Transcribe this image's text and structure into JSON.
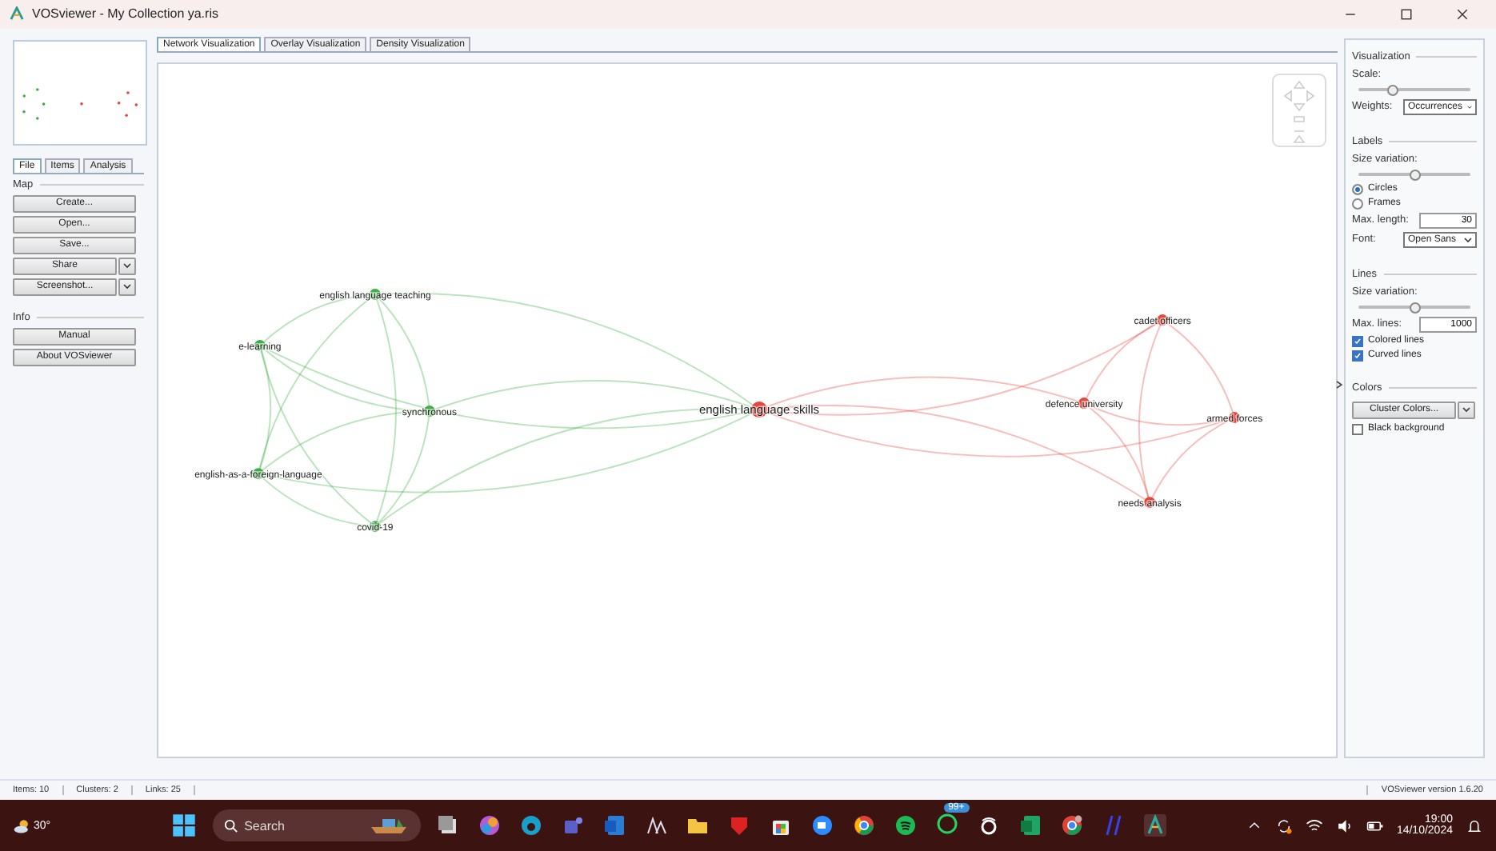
{
  "window": {
    "title": "VOSviewer - My Collection ya.ris"
  },
  "left_panel": {
    "tabs": [
      {
        "label": "File",
        "selected": true
      },
      {
        "label": "Items",
        "selected": false
      },
      {
        "label": "Analysis",
        "selected": false
      }
    ],
    "sections": [
      {
        "heading": "Map",
        "buttons": [
          {
            "label": "Create...",
            "kind": "plain"
          },
          {
            "label": "Open...",
            "kind": "plain"
          },
          {
            "label": "Save...",
            "kind": "plain"
          },
          {
            "label": "Share",
            "kind": "split"
          },
          {
            "label": "Screenshot...",
            "kind": "split"
          }
        ]
      },
      {
        "heading": "Info",
        "buttons": [
          {
            "label": "Manual",
            "kind": "plain"
          },
          {
            "label": "About VOSviewer",
            "kind": "plain"
          }
        ]
      }
    ]
  },
  "view_tabs": [
    {
      "label": "Network Visualization",
      "selected": true
    },
    {
      "label": "Overlay Visualization",
      "selected": false
    },
    {
      "label": "Density Visualization",
      "selected": false
    }
  ],
  "network": {
    "items": [
      {
        "label": "english language teaching",
        "color": "#3cb043"
      },
      {
        "label": "e-learning",
        "color": "#3cb043"
      },
      {
        "label": "synchronous",
        "color": "#3cb043"
      },
      {
        "label": "english-as-a-foreign-language",
        "color": "#3cb043"
      },
      {
        "label": "covid-19",
        "color": "#3cb043"
      },
      {
        "label": "english language skills",
        "color": "#e8453c"
      },
      {
        "label": "cadet officers",
        "color": "#e8453c"
      },
      {
        "label": "defence university",
        "color": "#e8453c"
      },
      {
        "label": "armed forces",
        "color": "#e8453c"
      },
      {
        "label": "needs analysis",
        "color": "#e8453c"
      }
    ]
  },
  "right_panel": {
    "visualization": {
      "heading": "Visualization",
      "scale_label": "Scale:",
      "scale": {
        "level": 0.3
      },
      "weights_label": "Weights:",
      "weights": "Occurrences"
    },
    "labels": {
      "heading": "Labels",
      "size_label": "Size variation:",
      "size": {
        "level": 0.5
      },
      "options": [
        {
          "label": "Circles",
          "selected": true
        },
        {
          "label": "Frames",
          "selected": false
        }
      ],
      "max_length_label": "Max. length:",
      "max_length": "30",
      "font_label": "Font:",
      "font": "Open Sans"
    },
    "lines": {
      "heading": "Lines",
      "size_label": "Size variation:",
      "size": {
        "level": 0.5
      },
      "max_lines_label": "Max. lines:",
      "max_lines": "1000",
      "checks": [
        {
          "label": "Colored lines",
          "checked": true
        },
        {
          "label": "Curved lines",
          "checked": true
        }
      ]
    },
    "colors": {
      "heading": "Colors",
      "button": "Cluster Colors...",
      "checks": [
        {
          "label": "Black background",
          "checked": false
        }
      ]
    }
  },
  "status_bar": {
    "items": [
      "Items:  10",
      "Clusters:  2",
      "Links:  25"
    ],
    "version": "VOSviewer version 1.6.20"
  },
  "taskbar": {
    "weather": "30°",
    "search_placeholder": "Search",
    "badge": "99+",
    "time": "19:00",
    "date": "14/10/2024"
  }
}
